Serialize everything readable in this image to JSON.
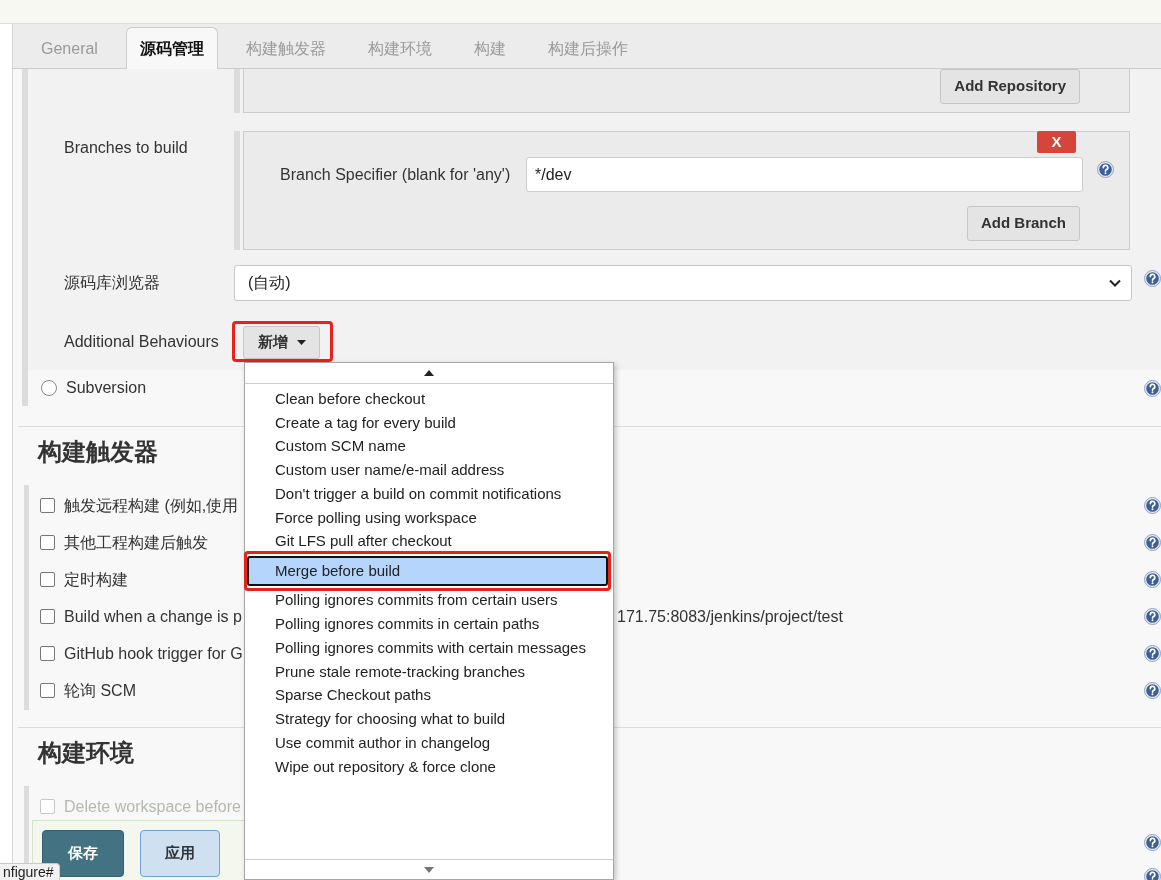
{
  "tabs": [
    {
      "label": "General",
      "selected": false
    },
    {
      "label": "源码管理",
      "selected": true
    },
    {
      "label": "构建触发器",
      "selected": false
    },
    {
      "label": "构建环境",
      "selected": false
    },
    {
      "label": "构建",
      "selected": false
    },
    {
      "label": "构建后操作",
      "selected": false
    }
  ],
  "scm": {
    "repository": {
      "add_button": "Add Repository"
    },
    "branches": {
      "label": "Branches to build",
      "remove_button": "X",
      "specifier_label": "Branch Specifier (blank for 'any')",
      "specifier_value": "*/dev",
      "add_button": "Add Branch"
    },
    "browser": {
      "label": "源码库浏览器",
      "value": "(自动)"
    },
    "behaviours": {
      "label": "Additional Behaviours",
      "button": "新增",
      "annotated": true
    },
    "subversion": {
      "label": "Subversion",
      "selected": false
    }
  },
  "behaviour_menu": {
    "items": [
      {
        "label": "Clean before checkout",
        "selected": false,
        "annotated": false
      },
      {
        "label": "Create a tag for every build",
        "selected": false,
        "annotated": false
      },
      {
        "label": "Custom SCM name",
        "selected": false,
        "annotated": false
      },
      {
        "label": "Custom user name/e-mail address",
        "selected": false,
        "annotated": false
      },
      {
        "label": "Don't trigger a build on commit notifications",
        "selected": false,
        "annotated": false
      },
      {
        "label": "Force polling using workspace",
        "selected": false,
        "annotated": false
      },
      {
        "label": "Git LFS pull after checkout",
        "selected": false,
        "annotated": false
      },
      {
        "label": "Merge before build",
        "selected": true,
        "annotated": true
      },
      {
        "label": "Polling ignores commits from certain users",
        "selected": false,
        "annotated": false
      },
      {
        "label": "Polling ignores commits in certain paths",
        "selected": false,
        "annotated": false
      },
      {
        "label": "Polling ignores commits with certain messages",
        "selected": false,
        "annotated": false
      },
      {
        "label": "Prune stale remote-tracking branches",
        "selected": false,
        "annotated": false
      },
      {
        "label": "Sparse Checkout paths",
        "selected": false,
        "annotated": false
      },
      {
        "label": "Strategy for choosing what to build",
        "selected": false,
        "annotated": false
      },
      {
        "label": "Use commit author in changelog",
        "selected": false,
        "annotated": false
      },
      {
        "label": "Wipe out repository & force clone",
        "selected": false,
        "annotated": false
      }
    ]
  },
  "triggers": {
    "title": "构建触发器",
    "items": [
      {
        "label": "触发远程构建 (例如,使用",
        "checked": false
      },
      {
        "label": "其他工程构建后触发",
        "checked": false
      },
      {
        "label": "定时构建",
        "checked": false
      },
      {
        "label": "Build when a change is p",
        "continuation": "171.75:8083/jenkins/project/test",
        "checked": false
      },
      {
        "label": "GitHub hook trigger for G",
        "checked": false
      },
      {
        "label": "轮询 SCM",
        "checked": false
      }
    ]
  },
  "environment": {
    "title": "构建环境",
    "items": [
      {
        "label": "Delete workspace before",
        "checked": false
      }
    ]
  },
  "actions": {
    "save": "保存",
    "apply": "应用"
  },
  "status_url": "nfigure#"
}
